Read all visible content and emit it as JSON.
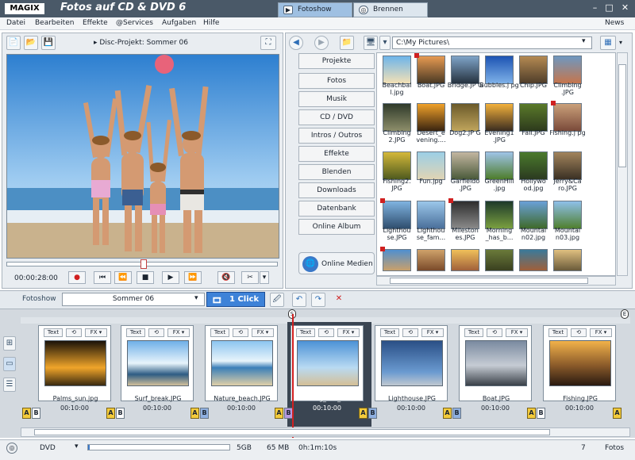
{
  "app": {
    "logo": "MAGIX",
    "title": "Fotos auf CD & DVD 6",
    "tabs": [
      {
        "label": "Fotoshow",
        "icon": "▶",
        "active": true
      },
      {
        "label": "Brennen",
        "icon": "◎",
        "active": false
      }
    ],
    "news": "News"
  },
  "menu": [
    "Datei",
    "Bearbeiten",
    "Effekte",
    "@Services",
    "Aufgaben",
    "Hilfe"
  ],
  "preview": {
    "project_label": "Disc-Projekt: Sommer 06",
    "timecode": "00:00:28:00"
  },
  "browser": {
    "path": "C:\\My Pictures\\",
    "nav": [
      "Projekte",
      "Fotos",
      "Musik",
      "CD / DVD",
      "Intros / Outros",
      "Effekte",
      "Blenden",
      "Downloads",
      "Datenbank",
      "Online Album"
    ],
    "online_button": "Online Medien",
    "files": [
      [
        "Beachbal l.jpg",
        "Boat.JPG",
        "Bridge.JP G",
        "Bubbles.j pg",
        "Chip.JPG",
        "Climbing .JPG"
      ],
      [
        "Climbing 2.JPG",
        "Desert_e vening....",
        "Dog2.JP G",
        "Evening1 .JPG",
        "Fall.JPG",
        "Fishing.j pg"
      ],
      [
        "Fishing2. JPG",
        "Fun.jpg",
        "Garfieldo .JPG",
        "GreenHill .jpg",
        "Hollywo od.jpg",
        "Jerry&Ca ro.JPG"
      ],
      [
        "Lighthou se.JPG",
        "Lighthou se_fam...",
        "Mileston es.JPG",
        "Morning _has_b...",
        "Mountai n02.jpg",
        "Mountai n03.jpg"
      ]
    ]
  },
  "show": {
    "label": "Fotoshow",
    "name": "Sommer 06",
    "one_click": "1 Click",
    "marker_s": "S",
    "marker_e": "E"
  },
  "strip": {
    "labels": {
      "text": "Text",
      "fx": "FX ▾",
      "a": "A",
      "b": "B"
    },
    "items": [
      {
        "name": "Palms_sun.jpg",
        "duration": "00:10:00"
      },
      {
        "name": "Surf_break.JPG",
        "duration": "00:10:00"
      },
      {
        "name": "Nature_beach.JPG",
        "duration": "00:10:00"
      },
      {
        "name": "Morning_has_broke",
        "duration": "00:10:00",
        "selected": true
      },
      {
        "name": "Lighthouse.JPG",
        "duration": "00:10:00"
      },
      {
        "name": "Boat.JPG",
        "duration": "00:10:00"
      },
      {
        "name": "Fishing.JPG",
        "duration": "00:10:00"
      }
    ]
  },
  "status": {
    "media": "DVD",
    "capacity": "5GB",
    "used": "65 MB",
    "duration": "0h:1m:10s",
    "count": "7",
    "count_label": "Fotos",
    "fill_level": 0.01
  }
}
